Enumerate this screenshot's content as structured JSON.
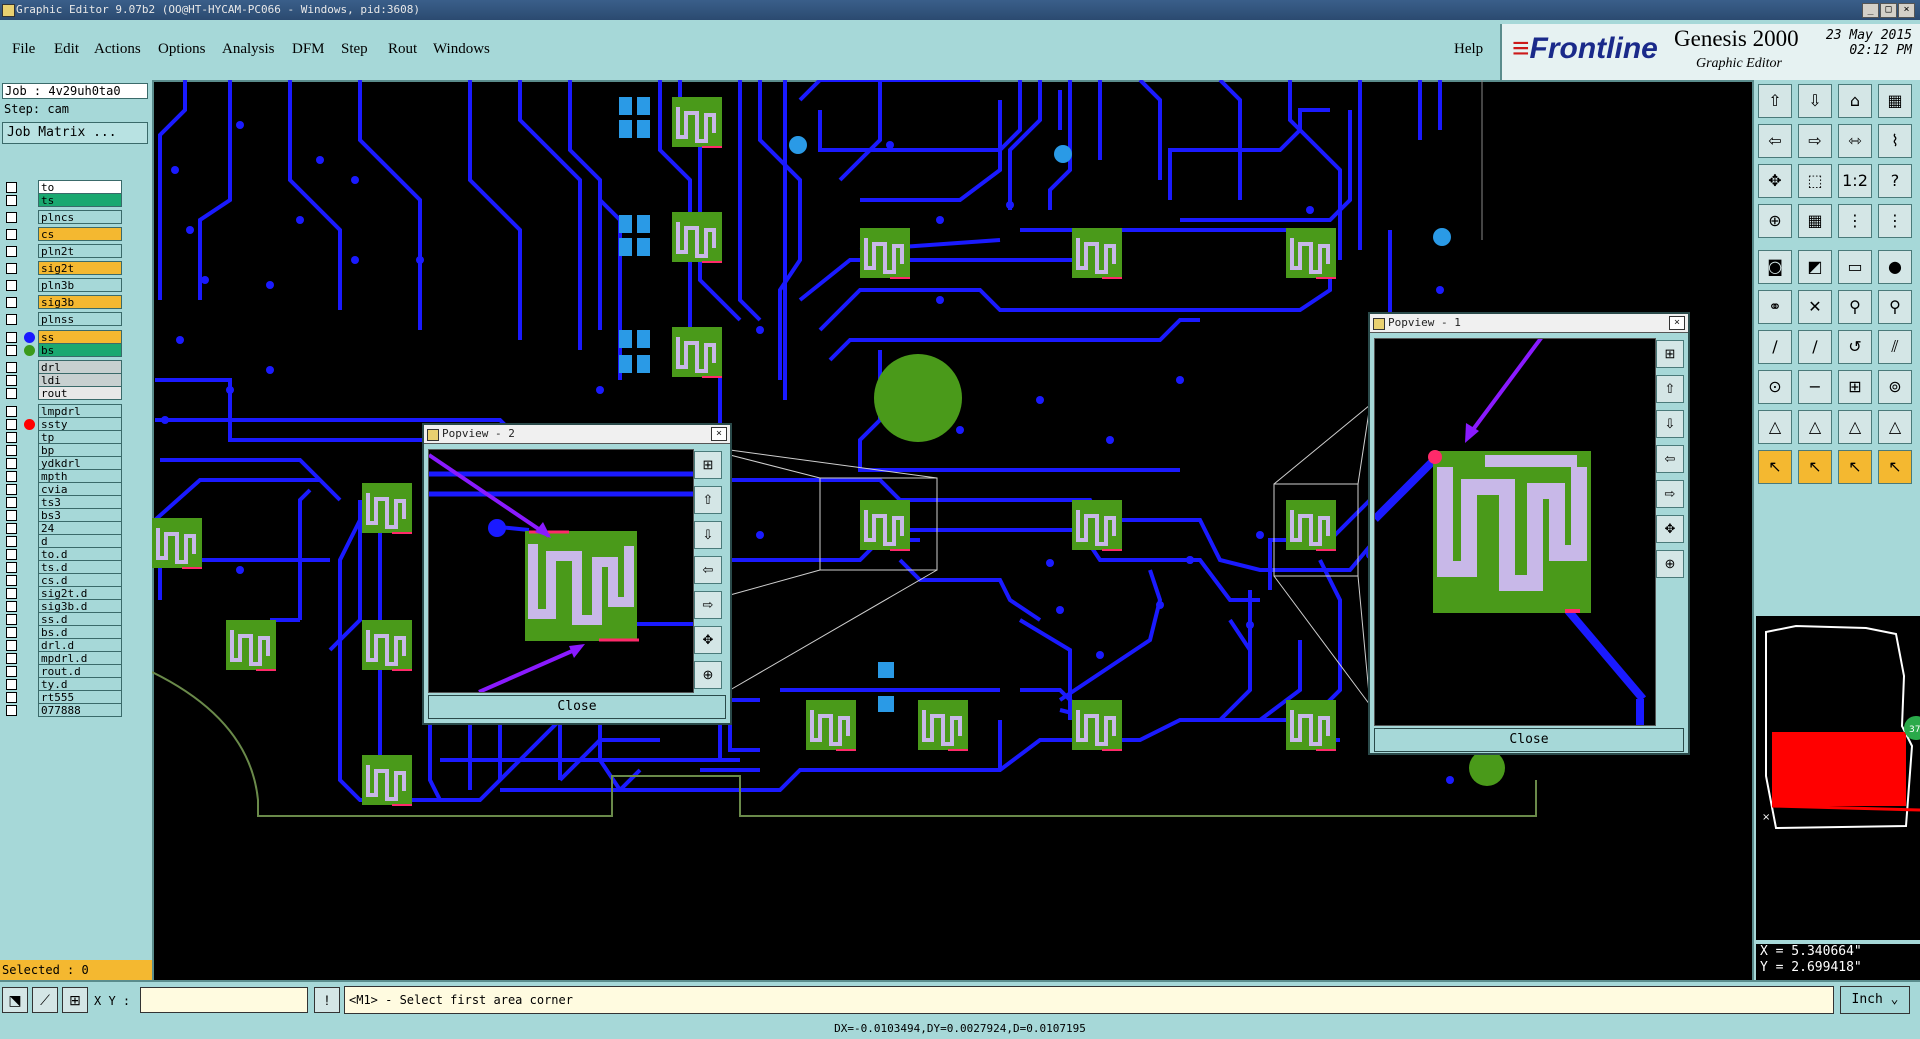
{
  "window": {
    "title": "Graphic Editor 9.07b2 (OO@HT-HYCAM-PC066 - Windows, pid:3608)",
    "min_btn": "_",
    "max_btn": "□",
    "close_btn": "×"
  },
  "menu": {
    "items": [
      "File",
      "Edit",
      "Actions",
      "Options",
      "Analysis",
      "DFM",
      "Step",
      "Rout",
      "Windows"
    ],
    "help": "Help"
  },
  "brand": {
    "logo_prefix": "≡",
    "logo": "Frontline",
    "product": "Genesis 2000",
    "subtitle": "Graphic Editor",
    "date": "23 May 2015",
    "time": "02:12 PM"
  },
  "left_panel": {
    "job": "Job : 4v29uh0ta0",
    "step": "Step: cam",
    "job_matrix": "Job Matrix ...",
    "selected": "Selected : 0",
    "layers": [
      {
        "name": "to",
        "color": "#ffffff",
        "dot": ""
      },
      {
        "name": "ts",
        "color": "#1aa870",
        "dot": ""
      },
      {
        "name": "plncs",
        "color": "#a6d8d8",
        "dot": ""
      },
      {
        "name": "cs",
        "color": "#f4b830",
        "dot": ""
      },
      {
        "name": "pln2t",
        "color": "#a6d8d8",
        "dot": ""
      },
      {
        "name": "sig2t",
        "color": "#f4b830",
        "dot": ""
      },
      {
        "name": "pln3b",
        "color": "#a6d8d8",
        "dot": ""
      },
      {
        "name": "sig3b",
        "color": "#f4b830",
        "dot": ""
      },
      {
        "name": "plnss",
        "color": "#a6d8d8",
        "dot": ""
      },
      {
        "name": "ss",
        "color": "#f4b830",
        "dot": "#1a1aff"
      },
      {
        "name": "bs",
        "color": "#1aa870",
        "dot": "#3a9a1a"
      },
      {
        "name": "drl",
        "color": "#c8d0d0",
        "dot": ""
      },
      {
        "name": "ldi",
        "color": "#c8d0d0",
        "dot": ""
      },
      {
        "name": "rout",
        "color": "#e8e8e8",
        "dot": ""
      },
      {
        "name": "lmpdrl",
        "color": "#a6d8d8",
        "dot": ""
      },
      {
        "name": "ssty",
        "color": "#a6d8d8",
        "dot": "#ff0000"
      },
      {
        "name": "tp",
        "color": "#a6d8d8",
        "dot": ""
      },
      {
        "name": "bp",
        "color": "#a6d8d8",
        "dot": ""
      },
      {
        "name": "ydkdrl",
        "color": "#a6d8d8",
        "dot": ""
      },
      {
        "name": "mpth",
        "color": "#a6d8d8",
        "dot": ""
      },
      {
        "name": "cvia",
        "color": "#a6d8d8",
        "dot": ""
      },
      {
        "name": "ts3",
        "color": "#a6d8d8",
        "dot": ""
      },
      {
        "name": "bs3",
        "color": "#a6d8d8",
        "dot": ""
      },
      {
        "name": "24",
        "color": "#a6d8d8",
        "dot": ""
      },
      {
        "name": "d",
        "color": "#a6d8d8",
        "dot": ""
      },
      {
        "name": "to.d",
        "color": "#a6d8d8",
        "dot": ""
      },
      {
        "name": "ts.d",
        "color": "#a6d8d8",
        "dot": ""
      },
      {
        "name": "cs.d",
        "color": "#a6d8d8",
        "dot": ""
      },
      {
        "name": "sig2t.d",
        "color": "#a6d8d8",
        "dot": ""
      },
      {
        "name": "sig3b.d",
        "color": "#a6d8d8",
        "dot": ""
      },
      {
        "name": "ss.d",
        "color": "#a6d8d8",
        "dot": ""
      },
      {
        "name": "bs.d",
        "color": "#a6d8d8",
        "dot": ""
      },
      {
        "name": "drl.d",
        "color": "#a6d8d8",
        "dot": ""
      },
      {
        "name": "mpdrl.d",
        "color": "#a6d8d8",
        "dot": ""
      },
      {
        "name": "rout.d",
        "color": "#a6d8d8",
        "dot": ""
      },
      {
        "name": "ty.d",
        "color": "#a6d8d8",
        "dot": ""
      },
      {
        "name": "rt555",
        "color": "#a6d8d8",
        "dot": ""
      },
      {
        "name": "077888",
        "color": "#a6d8d8",
        "dot": ""
      }
    ]
  },
  "popups": {
    "popview2": {
      "title": "Popview - 2",
      "close": "Close",
      "close_x": "×"
    },
    "popview1": {
      "title": "Popview - 1",
      "close": "Close",
      "close_x": "×"
    }
  },
  "right_panel": {
    "toolbar": [
      "⇧",
      "⇩",
      "⌂",
      "▦",
      "⇦",
      "⇨",
      "⇿",
      "⌇",
      "✥",
      "⬚",
      "1:2",
      "?",
      "⊕",
      "▦",
      "⋮",
      "⋮",
      "◙",
      "◩",
      "▭",
      "●",
      "⚭",
      "✕",
      "⚲",
      "⚲",
      "∕",
      "∕",
      "↺",
      "⫽",
      "⊙",
      "−",
      "⊞",
      "⊚",
      "△",
      "△",
      "△",
      "△",
      "↖",
      "↖",
      "↖",
      "↖"
    ],
    "coord_x": "X = 5.340664\"",
    "coord_y": "Y = 2.699418\"",
    "minimap_badge": "37"
  },
  "bottom": {
    "xy_label": "X Y :",
    "xy_value": "",
    "prompt": "<M1> - Select first area corner",
    "unit": "Inch",
    "status": "DX=-0.0103494,DY=0.0027924,D=0.0107195"
  },
  "colors": {
    "panel": "#a6d8d8",
    "trace": "#1a1aff",
    "pad": "#4a9a1a",
    "mask": "#c8b8e8",
    "highlight": "#ff2a6a",
    "arrow": "#8a1aff"
  }
}
